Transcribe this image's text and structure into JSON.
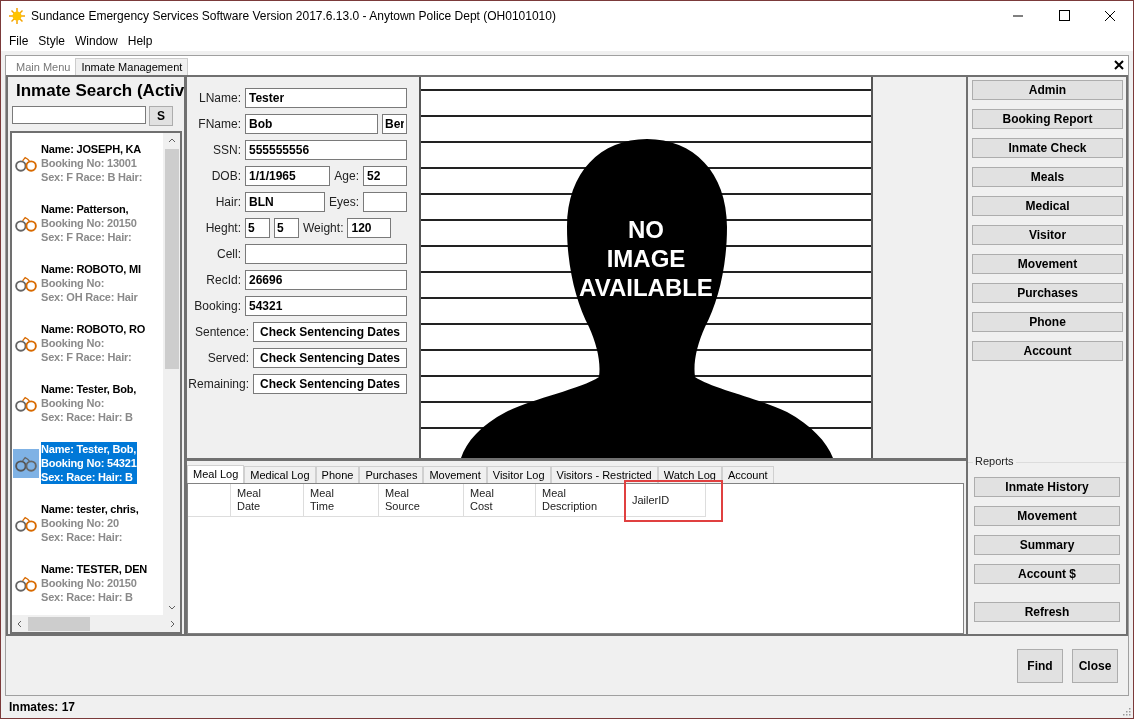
{
  "window": {
    "title": "Sundance Emergency Services Software Version 2017.6.13.0 - Anytown Police Dept (OH0101010)"
  },
  "menu": [
    "File",
    "Style",
    "Window",
    "Help"
  ],
  "tabs": [
    {
      "label": "Main Menu",
      "selected": false
    },
    {
      "label": "Inmate Management",
      "selected": true
    }
  ],
  "search": {
    "title": "Inmate Search (Activ",
    "button": "S"
  },
  "inmates": [
    {
      "name": "Name: JOSEPH, KA",
      "booking": "Booking No: 13001",
      "details": "Sex: F Race: B Hair:",
      "selected": false
    },
    {
      "name": "Name: Patterson,",
      "booking": "Booking No: 20150",
      "details": "Sex: F Race:  Hair:",
      "selected": false
    },
    {
      "name": "Name: ROBOTO, MI",
      "booking": "Booking No:",
      "details": "Sex: OH Race:  Hair",
      "selected": false
    },
    {
      "name": "Name: ROBOTO, RO",
      "booking": "Booking No:",
      "details": "Sex: F Race:  Hair:",
      "selected": false
    },
    {
      "name": "Name: Tester, Bob,",
      "booking": "Booking No:",
      "details": "Sex:  Race:  Hair: B",
      "selected": false
    },
    {
      "name": "Name: Tester, Bob,",
      "booking": "Booking No: 54321",
      "details": "Sex:  Race:  Hair: B",
      "selected": true
    },
    {
      "name": "Name: tester, chris,",
      "booking": "Booking No: 20",
      "details": "Sex:  Race:  Hair:",
      "selected": false
    },
    {
      "name": "Name: TESTER, DEN",
      "booking": "Booking No: 20150",
      "details": "Sex:  Race:  Hair: B",
      "selected": false
    }
  ],
  "form": [
    {
      "kind": "fields",
      "label": "LName:",
      "fields": [
        {
          "value": "Tester"
        }
      ]
    },
    {
      "kind": "fields",
      "label": "FName:",
      "fields": [
        {
          "value": "Bob"
        },
        {
          "value": "Ber"
        }
      ]
    },
    {
      "kind": "fields",
      "label": "SSN:",
      "fields": [
        {
          "value": "555555556"
        }
      ]
    },
    {
      "kind": "fields",
      "label": "DOB:",
      "fields": [
        {
          "value": "1/1/1965"
        },
        {
          "label": "Age:",
          "value": "52"
        }
      ]
    },
    {
      "kind": "fields",
      "label": "Hair:",
      "fields": [
        {
          "value": "BLN"
        },
        {
          "label": "Eyes:"
        }
      ]
    },
    {
      "kind": "fields",
      "label": "Heght:",
      "fields": [
        {
          "value": "5"
        },
        {
          "value": "5"
        },
        {
          "label": "Weight:",
          "value": "120"
        }
      ]
    },
    {
      "kind": "fields",
      "label": "Cell:"
    },
    {
      "kind": "fields",
      "label": "RecId:",
      "fields": [
        {
          "value": "26696"
        }
      ]
    },
    {
      "kind": "fields",
      "label": "Booking:",
      "fields": [
        {
          "value": "54321"
        }
      ]
    },
    {
      "kind": "button",
      "label": "Sentence:",
      "button": "Check Sentencing Dates"
    },
    {
      "kind": "button",
      "label": "Served:",
      "button": "Check Sentencing Dates"
    },
    {
      "kind": "button",
      "label": "Remaining:",
      "button": "Check Sentencing Dates"
    }
  ],
  "photo": {
    "caption": [
      "NO",
      "IMAGE",
      "AVAILABLE"
    ]
  },
  "actions": [
    "Admin",
    "Booking Report",
    "Inmate Check",
    "Meals",
    "Medical",
    "Visitor",
    "Movement",
    "Purchases",
    "Phone",
    "Account"
  ],
  "reports": {
    "title": "Reports",
    "buttons": [
      "Inmate History",
      "Movement",
      "Summary",
      "Account $"
    ],
    "refresh": "Refresh"
  },
  "log_tabs": [
    {
      "label": "Meal Log",
      "selected": true
    },
    {
      "label": "Medical Log",
      "selected": false
    },
    {
      "label": "Phone",
      "selected": false
    },
    {
      "label": "Purchases",
      "selected": false
    },
    {
      "label": "Movement",
      "selected": false
    },
    {
      "label": "Visitor Log",
      "selected": false
    },
    {
      "label": "Visitors - Restricted",
      "selected": false
    },
    {
      "label": "Watch Log",
      "selected": false
    },
    {
      "label": "Account",
      "selected": false
    }
  ],
  "log_columns": [
    {
      "label": "Meal\nDate"
    },
    {
      "label": "Meal\nTime"
    },
    {
      "label": "Meal\nSource"
    },
    {
      "label": "Meal\nCost"
    },
    {
      "label": "Meal\nDescription"
    },
    {
      "label": "JailerID",
      "highlighted": true
    }
  ],
  "bottom_buttons": [
    "Find",
    "Close"
  ],
  "status_bar": "Inmates: 17"
}
